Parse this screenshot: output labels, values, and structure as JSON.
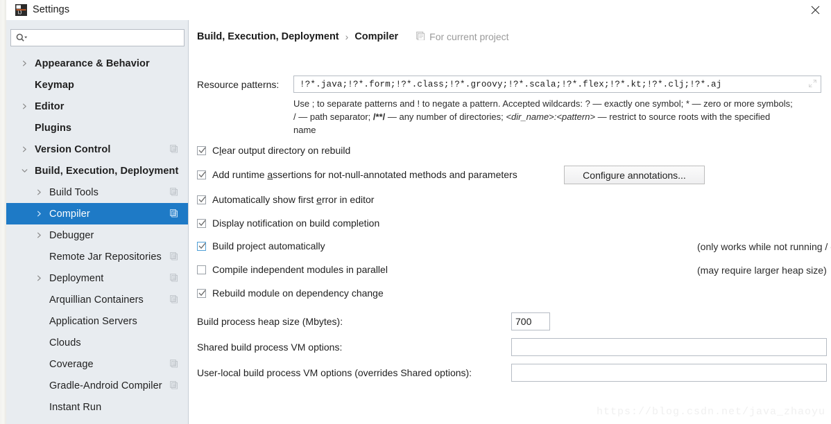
{
  "window": {
    "title": "Settings",
    "app_icon": "intellij-idea-icon",
    "close_icon": "close-icon"
  },
  "colors": {
    "selection_blue": "#1e7ac6",
    "sidebar_bg": "#e8ecf0",
    "panel_bg": "#ffffff",
    "border": "#b6bcc4",
    "hint_text": "#2b2b2b",
    "muted_text": "#9a9a9a",
    "checkbox_focus": "#4f9fd6"
  },
  "sidebar": {
    "search": {
      "placeholder": "",
      "value": "",
      "icon": "search-icon"
    },
    "items": [
      {
        "label": "Appearance & Behavior",
        "arrow": "right",
        "bold": true,
        "indent": 0,
        "selected": false,
        "scope_icon": false
      },
      {
        "label": "Keymap",
        "arrow": "none",
        "bold": true,
        "indent": 0,
        "selected": false,
        "scope_icon": false
      },
      {
        "label": "Editor",
        "arrow": "right",
        "bold": true,
        "indent": 0,
        "selected": false,
        "scope_icon": false
      },
      {
        "label": "Plugins",
        "arrow": "none",
        "bold": true,
        "indent": 0,
        "selected": false,
        "scope_icon": false
      },
      {
        "label": "Version Control",
        "arrow": "right",
        "bold": true,
        "indent": 0,
        "selected": false,
        "scope_icon": true
      },
      {
        "label": "Build, Execution, Deployment",
        "arrow": "down",
        "bold": true,
        "indent": 0,
        "selected": false,
        "scope_icon": false
      },
      {
        "label": "Build Tools",
        "arrow": "right",
        "bold": false,
        "indent": 1,
        "selected": false,
        "scope_icon": true
      },
      {
        "label": "Compiler",
        "arrow": "right",
        "bold": false,
        "indent": 1,
        "selected": true,
        "scope_icon": true
      },
      {
        "label": "Debugger",
        "arrow": "right",
        "bold": false,
        "indent": 1,
        "selected": false,
        "scope_icon": false
      },
      {
        "label": "Remote Jar Repositories",
        "arrow": "none",
        "bold": false,
        "indent": 1,
        "selected": false,
        "scope_icon": true
      },
      {
        "label": "Deployment",
        "arrow": "right",
        "bold": false,
        "indent": 1,
        "selected": false,
        "scope_icon": true
      },
      {
        "label": "Arquillian Containers",
        "arrow": "none",
        "bold": false,
        "indent": 1,
        "selected": false,
        "scope_icon": true
      },
      {
        "label": "Application Servers",
        "arrow": "none",
        "bold": false,
        "indent": 1,
        "selected": false,
        "scope_icon": false
      },
      {
        "label": "Clouds",
        "arrow": "none",
        "bold": false,
        "indent": 1,
        "selected": false,
        "scope_icon": false
      },
      {
        "label": "Coverage",
        "arrow": "none",
        "bold": false,
        "indent": 1,
        "selected": false,
        "scope_icon": true
      },
      {
        "label": "Gradle-Android Compiler",
        "arrow": "none",
        "bold": false,
        "indent": 1,
        "selected": false,
        "scope_icon": true
      },
      {
        "label": "Instant Run",
        "arrow": "none",
        "bold": false,
        "indent": 1,
        "selected": false,
        "scope_icon": false
      }
    ]
  },
  "main": {
    "breadcrumb": {
      "root": "Build, Execution, Deployment",
      "separator": "›",
      "leaf": "Compiler"
    },
    "project_scope": {
      "icon": "project-scope-icon",
      "label": "For current project"
    },
    "resource_patterns": {
      "label": "Resource patterns:",
      "value": "!?*.java;!?*.form;!?*.class;!?*.groovy;!?*.scala;!?*.flex;!?*.kt;!?*.clj;!?*.aj",
      "placeholder": "",
      "expand_icon": "expand-icon",
      "help_line1_a": "Use ; to separate patterns and ! to negate a pattern. Accepted wildcards: ",
      "help_line1_b": "? — exactly one symbol; * — zero or more symbols;",
      "help_line2_a": "/ — path separator; ",
      "help_line2_b": "/**/",
      "help_line2_c": " — any number of directories; ",
      "help_line2_d": "<dir_name>:<pattern>",
      "help_line2_e": " — restrict to source roots with the specified",
      "help_line3": "name"
    },
    "checkboxes": [
      {
        "label_pre": "C",
        "label_mnemonic": "l",
        "label_post": "ear output directory on rebuild",
        "checked": true,
        "focused": false,
        "hint": ""
      },
      {
        "label_pre": "Add runtime ",
        "label_mnemonic": "a",
        "label_post": "ssertions for not-null-annotated methods and parameters",
        "checked": true,
        "focused": false,
        "hint": ""
      },
      {
        "label_pre": "Automatically show first ",
        "label_mnemonic": "e",
        "label_post": "rror in editor",
        "checked": true,
        "focused": false,
        "hint": ""
      },
      {
        "label_pre": "Display notification on build completion",
        "label_mnemonic": "",
        "label_post": "",
        "checked": true,
        "focused": false,
        "hint": ""
      },
      {
        "label_pre": "Build project automatically",
        "label_mnemonic": "",
        "label_post": "",
        "checked": true,
        "focused": true,
        "hint": "(only works while not running / debugging)"
      },
      {
        "label_pre": "Compile independent modules in parallel",
        "label_mnemonic": "",
        "label_post": "",
        "checked": false,
        "focused": false,
        "hint": "(may require larger heap size)"
      },
      {
        "label_pre": "Rebuild module on dependency change",
        "label_mnemonic": "",
        "label_post": "",
        "checked": true,
        "focused": false,
        "hint": ""
      }
    ],
    "configure_annotations_button": "Configure annotations...",
    "fields": [
      {
        "label": "Build process heap size (Mbytes):",
        "value": "700",
        "placeholder": ""
      },
      {
        "label": "Shared build process VM options:",
        "value": "",
        "placeholder": ""
      },
      {
        "label": "User-local build process VM options (overrides Shared options):",
        "value": "",
        "placeholder": ""
      }
    ]
  },
  "watermark": "https://blog.csdn.net/java_zhaoyu"
}
